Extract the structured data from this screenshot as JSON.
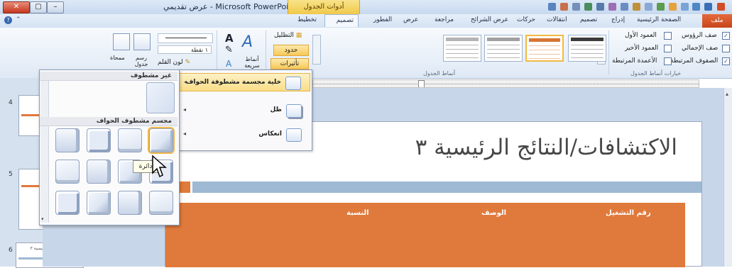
{
  "window": {
    "title": "Microsoft PowerPoint - عرض تقديمي",
    "context_tab_group": "أدوات الجدول"
  },
  "tabs": {
    "file": "ملف",
    "items": [
      "الصفحة الرئيسية",
      "إدراج",
      "تصميم",
      "انتقالات",
      "حركات",
      "عرض الشرائح",
      "مراجعة",
      "عرض",
      "الفطور",
      "تصميم",
      "تخطيط"
    ],
    "active": "تصميم"
  },
  "ribbon": {
    "options": {
      "header_row": "صف الرؤوس",
      "total_row": "صف الإجمالي",
      "banded_rows": "الصفوف المرتبطة",
      "first_column": "العمود الأول",
      "last_column": "العمود الأخير",
      "banded_columns": "الأعمدة المرتبطة",
      "group_label": "خيارات أنماط الجدول"
    },
    "styles_group_label": "أنماط الجدول",
    "shading": "التظليل",
    "borders": "حدود",
    "effects": "تأثيرات",
    "wordart": {
      "quick_styles": "أنماط سريعة"
    },
    "pen_weight": "١ نقطة",
    "pen_color": "لون القلم",
    "draw_table": "رسم جدول",
    "eraser": "ممحاة"
  },
  "effects_menu": {
    "items": [
      "خلية مجسمة مشطوفة الحواف",
      "ظل",
      "انعكاس"
    ]
  },
  "bevel_gallery": {
    "no_bevel_header": "غير مشطوف",
    "bevel_header": "مجسم مشطوف الحواف",
    "tooltip": "دائرة"
  },
  "slides": {
    "numbers": [
      "4",
      "5",
      "6"
    ],
    "thumb6_title": "الاكتشافات/النتائج الرئيسية ٣"
  },
  "slide": {
    "title": "الاكتشافات/النتائج الرئيسية ٣",
    "table_headers": [
      "رقم التشغيل",
      "الوصف",
      "النسبة"
    ]
  },
  "colors": {
    "accent_orange": "#e07a3c",
    "accent_blue": "#9db9d3",
    "file_tab": "#d9542a"
  }
}
